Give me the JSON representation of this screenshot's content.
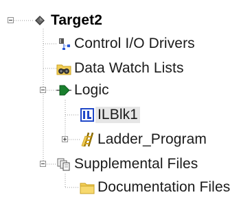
{
  "tree": {
    "root": {
      "label": "Target2",
      "icon": "diamond-icon",
      "expanded": true
    },
    "items": [
      {
        "label": "Control I/O Drivers",
        "icon": "io-drivers-icon"
      },
      {
        "label": "Data Watch Lists",
        "icon": "binoculars-folder-icon"
      },
      {
        "label": "Logic",
        "icon": "logic-arrow-icon",
        "expanded": true
      },
      {
        "label": "ILBlk1",
        "icon": "instruction-list-icon",
        "selected": true
      },
      {
        "label": "Ladder_Program",
        "icon": "ladder-icon",
        "expanded": false
      },
      {
        "label": "Supplemental Files",
        "icon": "files-stack-icon",
        "expanded": true
      },
      {
        "label": "Documentation Files",
        "icon": "folder-icon"
      }
    ]
  },
  "colors": {
    "connector": "#9a9a9a",
    "selection_bg": "#e6e6e6",
    "folder": "#f2cd55",
    "ladder": "#d4a017",
    "logic": "#1a7f2e",
    "il_blue": "#1f47c8"
  }
}
